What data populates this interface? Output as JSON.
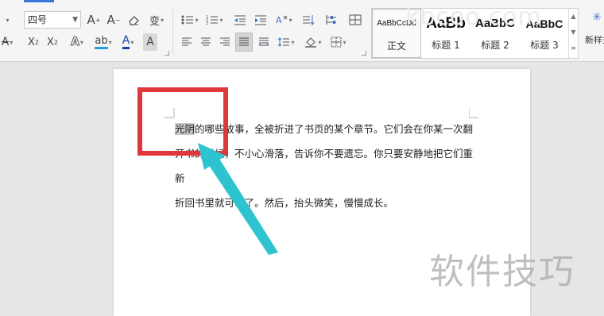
{
  "ribbon": {
    "font_size": "四号",
    "font_buttons": {
      "grow": "A⁺",
      "shrink": "A⁻",
      "clear_format": "◇",
      "phonetic": "wén"
    },
    "row2": {
      "strike": "A",
      "superscript": "X²",
      "subscript": "X₂",
      "text_effect": "A",
      "highlight": "ab",
      "font_color": "A",
      "char_shade": "A"
    },
    "styles": [
      {
        "sample": "AaBbCcDd",
        "label": "正文"
      },
      {
        "sample": "AaBb",
        "label": "标题 1"
      },
      {
        "sample": "AaBbC",
        "label": "标题 2"
      },
      {
        "sample": "AaBbC",
        "label": "标题 3"
      }
    ],
    "new_style": "新样式"
  },
  "document": {
    "lines": [
      {
        "highlight": "光阴",
        "rest": "的哪些故事，全被折进了书页的某个章节。它们会在你某一次翻"
      },
      {
        "highlight": "",
        "rest": "开书的时候，不小心滑落，告诉你不要遗忘。你只要安静地把它们重新"
      },
      {
        "highlight": "",
        "rest": "折回书里就可以了。然后，抬头微笑，慢慢成长。"
      }
    ]
  },
  "watermarks": {
    "top": "kbcoo.com",
    "bottom": "软件技巧"
  },
  "colors": {
    "annotation_red": "#e0373d",
    "arrow_cyan": "#2ec4cf",
    "tab_accent": "#3c78d8"
  }
}
